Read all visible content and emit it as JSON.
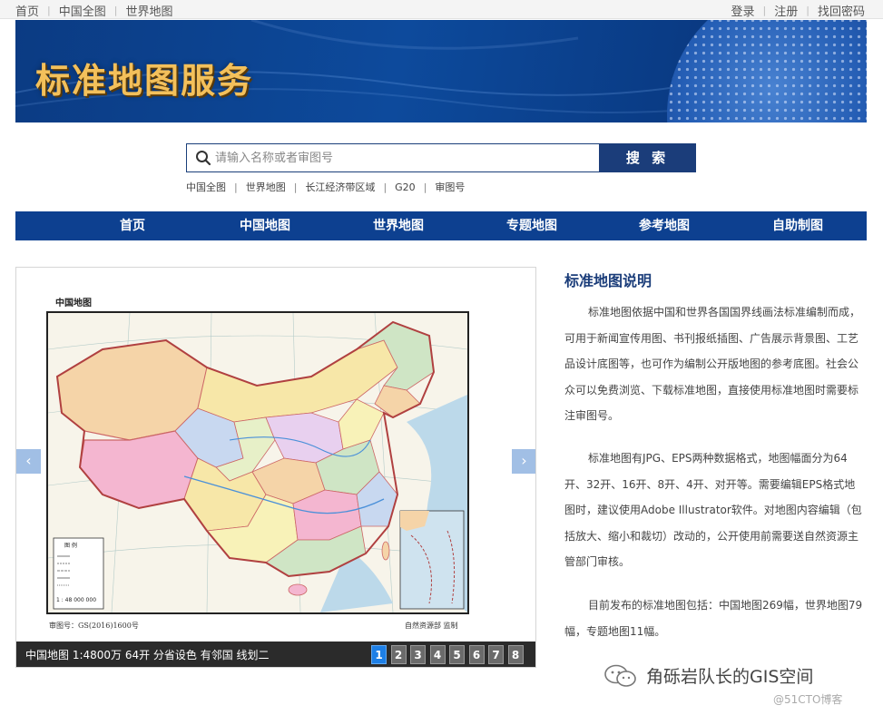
{
  "topbar": {
    "left_links": [
      "首页",
      "中国全图",
      "世界地图"
    ],
    "right_links": [
      "登录",
      "注册",
      "找回密码"
    ]
  },
  "banner": {
    "title": "标准地图服务"
  },
  "search": {
    "placeholder": "请输入名称或者审图号",
    "button_label": "搜 索",
    "hot_links": [
      "中国全图",
      "世界地图",
      "长江经济带区域",
      "G20",
      "审图号"
    ]
  },
  "nav": {
    "items": [
      "首页",
      "中国地图",
      "世界地图",
      "专题地图",
      "参考地图",
      "自助制图"
    ]
  },
  "slider": {
    "map_title": "中国地图",
    "map_approval": "审图号：GS(2016)1600号",
    "map_supervisor": "自然资源部 监制",
    "legend_title": "图  例",
    "legend_scale": "1 : 48 000 000",
    "caption": "中国地图 1:4800万 64开 分省设色 有邻国 线划二",
    "pages": [
      "1",
      "2",
      "3",
      "4",
      "5",
      "6",
      "7",
      "8"
    ],
    "active_page": "1",
    "prev_arrow": "‹",
    "next_arrow": "›"
  },
  "description": {
    "title": "标准地图说明",
    "paragraphs": [
      "标准地图依据中国和世界各国国界线画法标准编制而成，可用于新闻宣传用图、书刊报纸插图、广告展示背景图、工艺品设计底图等，也可作为编制公开版地图的参考底图。社会公众可以免费浏览、下载标准地图，直接使用标准地图时需要标注审图号。",
      "标准地图有JPG、EPS两种数据格式，地图幅面分为64开、32开、16开、8开、4开、对开等。需要编辑EPS格式地图时，建议使用Adobe Illustrator软件。对地图内容编辑（包括放大、缩小和裁切）改动的，公开使用前需要送自然资源主管部门审核。",
      "目前发布的标准地图包括：中国地图269幅，世界地图79幅，专题地图11幅。"
    ]
  },
  "watermark": {
    "text": "角砾岩队长的GIS空间",
    "sub": "@51CTO博客"
  },
  "colors": {
    "nav_bg": "#0d4090",
    "search_button": "#1b3d7a",
    "title_blue": "#1b3d7a",
    "page_active": "#1d7fe6"
  }
}
